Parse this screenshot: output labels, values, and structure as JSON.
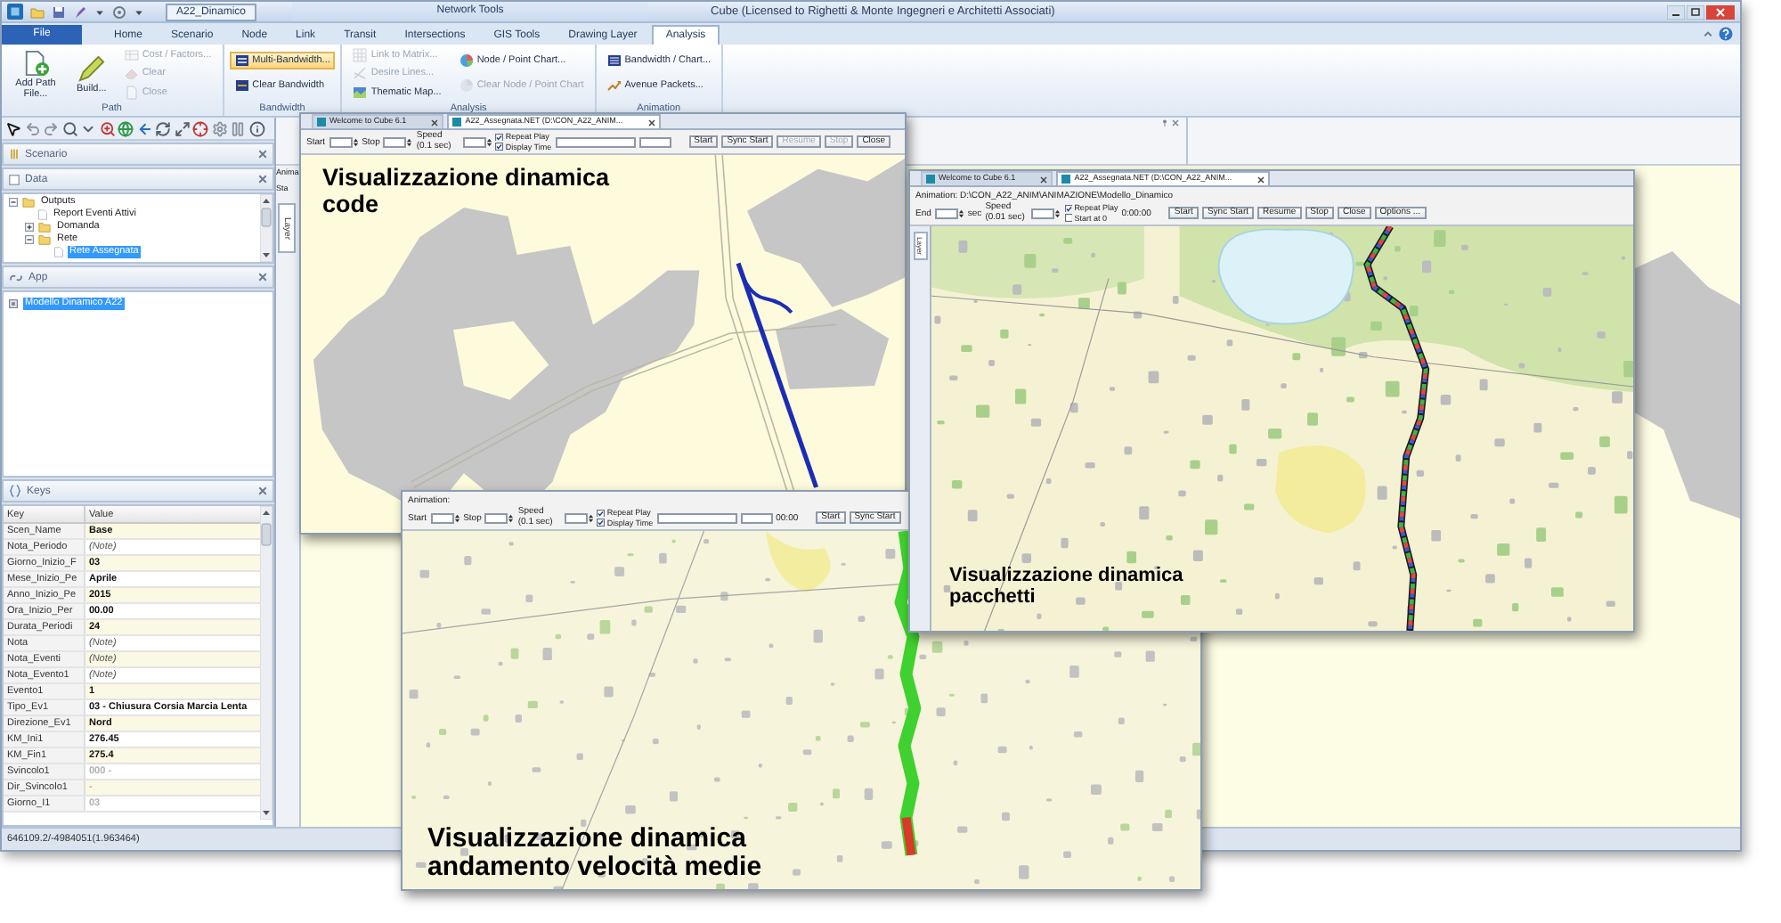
{
  "title_bar": {
    "document": "A22_Dinamico",
    "context_tab": "Network Tools",
    "title": "Cube (Licensed to Righetti & Monte Ingegneri e Architetti Associati)"
  },
  "ribbon_tabs": [
    {
      "label": "File",
      "kind": "file",
      "selected": false
    },
    {
      "label": "Home",
      "kind": "tab",
      "selected": false
    },
    {
      "label": "Scenario",
      "kind": "tab",
      "selected": false
    },
    {
      "label": "Node",
      "kind": "tab",
      "selected": false
    },
    {
      "label": "Link",
      "kind": "tab",
      "selected": false
    },
    {
      "label": "Transit",
      "kind": "tab",
      "selected": false
    },
    {
      "label": "Intersections",
      "kind": "tab",
      "selected": false
    },
    {
      "label": "GIS Tools",
      "kind": "tab",
      "selected": false
    },
    {
      "label": "Drawing Layer",
      "kind": "tab",
      "selected": false
    },
    {
      "label": "Analysis",
      "kind": "tab",
      "selected": true
    }
  ],
  "ribbon_groups": [
    {
      "label": "Path",
      "columns": [
        [
          {
            "label": "Add Path File...",
            "kind": "large",
            "disabled": false,
            "highlighted": false
          }
        ],
        [
          {
            "label": "Build...",
            "kind": "large",
            "disabled": false,
            "highlighted": false
          }
        ],
        [
          {
            "label": "Cost / Factors...",
            "kind": "small",
            "disabled": true,
            "highlighted": false
          },
          {
            "label": "Clear",
            "kind": "small",
            "disabled": true,
            "highlighted": false
          },
          {
            "label": "Close",
            "kind": "small",
            "disabled": true,
            "highlighted": false
          }
        ]
      ]
    },
    {
      "label": "Bandwidth",
      "columns": [
        [
          {
            "label": "Multi-Bandwidth...",
            "kind": "small",
            "disabled": false,
            "highlighted": true
          },
          {
            "label": "Clear Bandwidth",
            "kind": "small",
            "disabled": false,
            "highlighted": false
          }
        ]
      ]
    },
    {
      "label": "Analysis",
      "columns": [
        [
          {
            "label": "Link to Matrix...",
            "kind": "small",
            "disabled": true,
            "highlighted": false
          },
          {
            "label": "Desire Lines...",
            "kind": "small",
            "disabled": true,
            "highlighted": false
          },
          {
            "label": "Thematic Map...",
            "kind": "small",
            "disabled": false,
            "highlighted": false
          }
        ],
        [
          {
            "label": "Node / Point Chart...",
            "kind": "small",
            "disabled": false,
            "highlighted": false
          },
          {
            "label": "Clear Node / Point Chart",
            "kind": "small",
            "disabled": true,
            "highlighted": false
          }
        ]
      ]
    },
    {
      "label": "Animation",
      "columns": [
        [
          {
            "label": "Bandwidth / Chart...",
            "kind": "small",
            "disabled": false,
            "highlighted": false
          },
          {
            "label": "Avenue Packets...",
            "kind": "small",
            "disabled": false,
            "highlighted": false
          }
        ]
      ]
    }
  ],
  "scenario_panel": {
    "title": "Scenario"
  },
  "data_panel": {
    "title": "Data",
    "tree": [
      {
        "label": "Outputs",
        "kind": "folder",
        "expanded": true,
        "selected": false,
        "children": [
          {
            "label": "Report Eventi Attivi",
            "kind": "item",
            "selected": false
          },
          {
            "label": "Domanda",
            "kind": "folder",
            "expanded": false,
            "selected": false
          },
          {
            "label": "Rete",
            "kind": "folder",
            "expanded": true,
            "selected": false,
            "children": [
              {
                "label": "Rete Assegnata",
                "kind": "item",
                "selected": true
              }
            ]
          }
        ]
      }
    ]
  },
  "app_panel": {
    "title": "App",
    "items": [
      {
        "label": "Modello Dinamico A22",
        "selected": true
      }
    ]
  },
  "keys_panel": {
    "title": "Keys",
    "columns": [
      "Key",
      "Value"
    ],
    "rows": [
      {
        "key": "Scen_Name",
        "value": "Base",
        "kind": "value",
        "disabled": false
      },
      {
        "key": "Nota_Periodo",
        "value": "(Note)",
        "kind": "note",
        "disabled": false
      },
      {
        "key": "Giorno_Inizio_F",
        "value": "03",
        "kind": "value",
        "disabled": false
      },
      {
        "key": "Mese_Inizio_Pe",
        "value": "Aprile",
        "kind": "value",
        "disabled": false
      },
      {
        "key": "Anno_Inizio_Pe",
        "value": "2015",
        "kind": "value",
        "disabled": false
      },
      {
        "key": "Ora_Inizio_Per",
        "value": "00.00",
        "kind": "value",
        "disabled": false
      },
      {
        "key": "Durata_Periodi",
        "value": "24",
        "kind": "value",
        "disabled": false
      },
      {
        "key": "Nota",
        "value": "(Note)",
        "kind": "note",
        "disabled": false
      },
      {
        "key": "Nota_Eventi",
        "value": "(Note)",
        "kind": "note",
        "disabled": false
      },
      {
        "key": "Nota_Evento1",
        "value": "(Note)",
        "kind": "note",
        "disabled": false
      },
      {
        "key": "Evento1",
        "value": "1",
        "kind": "value",
        "disabled": false
      },
      {
        "key": "Tipo_Ev1",
        "value": "03 - Chiusura Corsia Marcia Lenta",
        "kind": "value",
        "disabled": false
      },
      {
        "key": "Direzione_Ev1",
        "value": "Nord",
        "kind": "value",
        "disabled": false
      },
      {
        "key": "KM_Ini1",
        "value": "276.45",
        "kind": "value",
        "disabled": false
      },
      {
        "key": "KM_Fin1",
        "value": "275.4",
        "kind": "value",
        "disabled": false
      },
      {
        "key": "Svincolo1",
        "value": "000 -",
        "kind": "value",
        "disabled": true
      },
      {
        "key": "Dir_Svincolo1",
        "value": "-",
        "kind": "value",
        "disabled": true
      },
      {
        "key": "Giorno_I1",
        "value": "03",
        "kind": "value",
        "disabled": true
      }
    ]
  },
  "status_bar": {
    "coordinates": "646109.2/-4984051(1.963464)"
  },
  "document": {
    "side_labels": [
      "Anima",
      "Sta"
    ],
    "side_tab": "Layer"
  },
  "windows": [
    {
      "kind": "roads",
      "tabs": [
        {
          "label": "Welcome to Cube 6.1",
          "selected": false
        },
        {
          "label": "A22_Assegnata.NET (D:\\CON_A22_ANIM...",
          "selected": true
        }
      ],
      "toolbar": [
        [
          {
            "kind": "label",
            "text": "Start"
          },
          {
            "kind": "spin_field"
          },
          {
            "kind": "label",
            "text": "Stop"
          },
          {
            "kind": "spin_field"
          },
          {
            "kind": "stacked_label",
            "text": "Speed (0.1 sec)"
          },
          {
            "kind": "spin_field"
          },
          {
            "kind": "checks",
            "items": [
              {
                "label": "Repeat Play",
                "checked": true
              },
              {
                "label": "Display Time",
                "checked": true
              }
            ]
          },
          {
            "kind": "long_field"
          },
          {
            "kind": "field"
          },
          {
            "kind": "button",
            "text": "Start",
            "disabled": false
          },
          {
            "kind": "button",
            "text": "Sync Start",
            "disabled": false
          },
          {
            "kind": "button",
            "text": "Resume",
            "disabled": true
          },
          {
            "kind": "button",
            "text": "Stop",
            "disabled": true
          },
          {
            "kind": "button",
            "text": "Close",
            "disabled": false
          }
        ]
      ],
      "caption": "Visualizzazione dinamica code"
    },
    {
      "kind": "packets",
      "tabs": [
        {
          "label": "Welcome to Cube 6.1",
          "selected": false
        },
        {
          "label": "A22_Assegnata.NET (D:\\CON_A22_ANIM...",
          "selected": true
        }
      ],
      "toolbar": [
        [
          {
            "kind": "label",
            "text": "Animation: D:\\CON_A22_ANIM\\ANIMAZIONE\\Modello_Dinamico"
          }
        ],
        [
          {
            "kind": "label",
            "text": "End"
          },
          {
            "kind": "spin_field"
          },
          {
            "kind": "label",
            "text": "sec"
          },
          {
            "kind": "stacked_label",
            "text": "Speed (0.01 sec)"
          },
          {
            "kind": "spin_field"
          },
          {
            "kind": "checks",
            "items": [
              {
                "label": "Repeat Play",
                "checked": true
              },
              {
                "label": "Start at 0",
                "checked": false
              }
            ]
          },
          {
            "kind": "label",
            "text": "0:00:00"
          },
          {
            "kind": "button",
            "text": "Start",
            "disabled": false
          },
          {
            "kind": "button",
            "text": "Sync Start",
            "disabled": false
          },
          {
            "kind": "button",
            "text": "Resume",
            "disabled": false
          },
          {
            "kind": "button",
            "text": "Stop",
            "disabled": false
          },
          {
            "kind": "button",
            "text": "Close",
            "disabled": false
          },
          {
            "kind": "button",
            "text": "Options ...",
            "disabled": false
          }
        ]
      ],
      "side_tab": "Layer",
      "caption": "Visualizzazione dinamica pacchetti"
    },
    {
      "kind": "speeds",
      "toolbar": [
        [
          {
            "kind": "label",
            "text": "Animation:"
          }
        ],
        [
          {
            "kind": "label",
            "text": "Start"
          },
          {
            "kind": "spin_field"
          },
          {
            "kind": "label",
            "text": "Stop"
          },
          {
            "kind": "spin_field"
          },
          {
            "kind": "stacked_label",
            "text": "Speed (0.1 sec)"
          },
          {
            "kind": "spin_field"
          },
          {
            "kind": "checks",
            "items": [
              {
                "label": "Repeat Play",
                "checked": true
              },
              {
                "label": "Display Time",
                "checked": true
              }
            ]
          },
          {
            "kind": "long_field"
          },
          {
            "kind": "field"
          },
          {
            "kind": "label",
            "text": "00:00"
          },
          {
            "kind": "button",
            "text": "Start",
            "disabled": false
          },
          {
            "kind": "button",
            "text": "Sync Start",
            "disabled": false
          }
        ]
      ],
      "caption": "Visualizzazione dinamica andamento velocità medie"
    }
  ]
}
